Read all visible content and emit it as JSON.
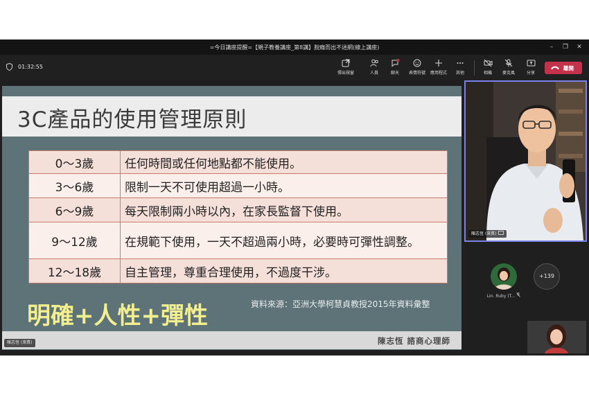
{
  "window": {
    "title": "=今日講座提醒=【親子教養講座_第8講】脫癮而出不迷網(線上講座)"
  },
  "toolbar": {
    "timer": "01:32:55",
    "popout_label": "彈出視窗",
    "people_label": "人員",
    "chat_label": "聊天",
    "reactions_label": "表情符號",
    "apps_label": "應用程式",
    "more_label": "其他",
    "camera_label": "相機",
    "mic_label": "麥克風",
    "share_label": "分享",
    "leave_label": "離開"
  },
  "slide": {
    "title": "3C產品的使用管理原則",
    "rows": [
      {
        "age": "0～3歲",
        "rule": "任何時間或任何地點都不能使用。"
      },
      {
        "age": "3～6歲",
        "rule": "限制一天不可使用超過一小時。"
      },
      {
        "age": "6～9歲",
        "rule": "每天限制兩小時以內，在家長監督下使用。"
      },
      {
        "age": "9～12歲",
        "rule": "在規範下使用，一天不超過兩小時，必要時可彈性調整。"
      },
      {
        "age": "12～18歲",
        "rule": "自主管理，尊重合理使用，不過度干涉。"
      }
    ],
    "motto": "明確+人性+彈性",
    "source": "資料來源：亞洲大學柯慧貞教授2015年資料彙整",
    "presenter": "陳志恆 諮商心理師"
  },
  "stage": {
    "presenter_label": "陳志恆 (來賓)"
  },
  "video": {
    "name_label": "陳志恆 (來賓)"
  },
  "participants": {
    "ruby_label": "Lin. Ruby (T...",
    "more_count": "+139"
  }
}
